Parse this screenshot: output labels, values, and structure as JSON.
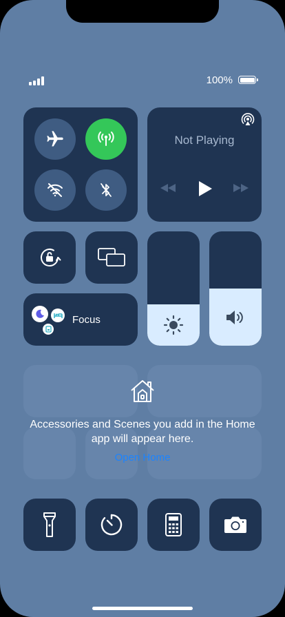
{
  "status": {
    "battery_text": "100%"
  },
  "connectivity": {
    "airplane": {
      "icon": "airplane-icon",
      "on": false
    },
    "cellular": {
      "icon": "antenna-icon",
      "on": true,
      "color": "#34c759"
    },
    "wifi": {
      "icon": "wifi-off-icon",
      "on": false
    },
    "bluetooth": {
      "icon": "bluetooth-off-icon",
      "on": false
    }
  },
  "media": {
    "title": "Not Playing"
  },
  "focus": {
    "label": "Focus"
  },
  "sliders": {
    "brightness_level": 0.36,
    "volume_level": 0.5
  },
  "home": {
    "message": "Accessories and Scenes you add in the Home app will appear here.",
    "link": "Open Home",
    "link_color": "#1b84ff"
  },
  "bottom_controls": [
    "flashlight-icon",
    "timer-icon",
    "calculator-icon",
    "camera-icon"
  ]
}
